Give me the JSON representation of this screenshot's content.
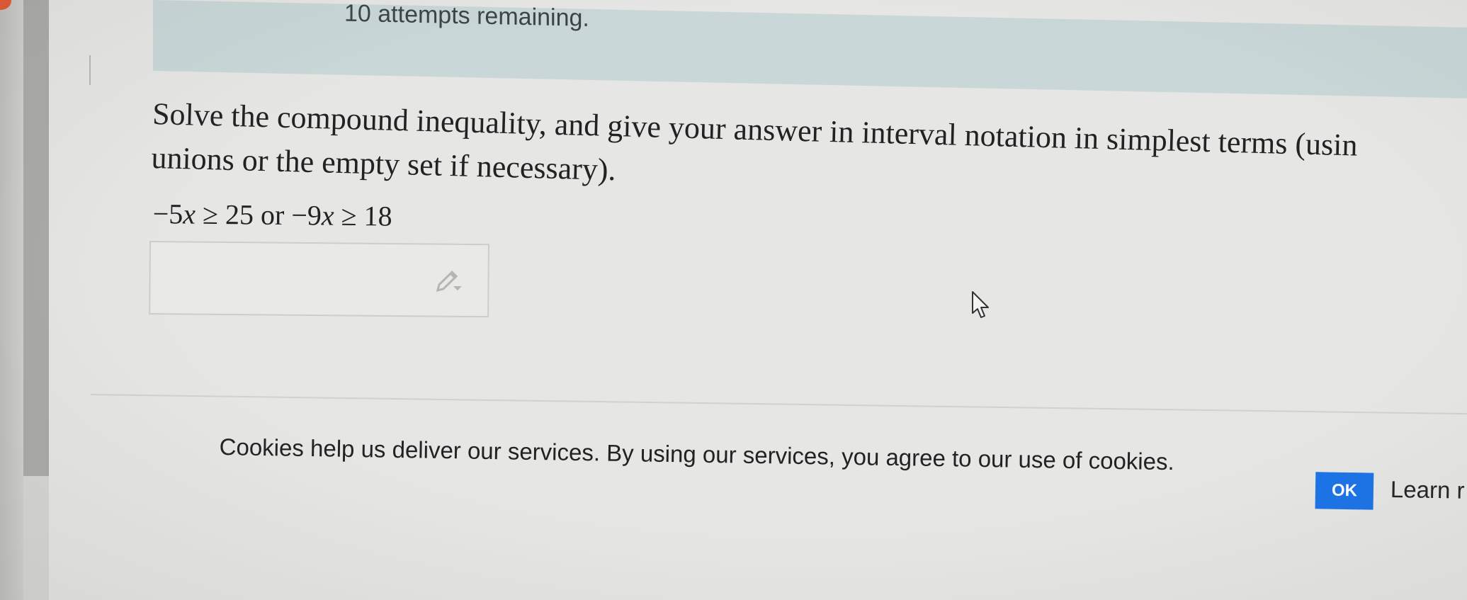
{
  "banner": {
    "attempts_text": "10 attempts remaining."
  },
  "question": {
    "line1": "Solve the compound inequality, and give your answer in interval notation in simplest terms (usin",
    "line2": "unions or the empty set if necessary).",
    "math": {
      "part1_coef": "−5",
      "part1_var": "x",
      "part1_rel": " ≥ 25",
      "connector": " or ",
      "part2_coef": "−9",
      "part2_var": "x",
      "part2_rel": " ≥ 18"
    }
  },
  "answer": {
    "value": "",
    "tool_icon": "pencil-icon"
  },
  "cookie_bar": {
    "message": "Cookies help us deliver our services. By using our services, you agree to our use of cookies.",
    "ok_label": "OK",
    "learn_label": "Learn r",
    "ok_color": "#1a73e8"
  },
  "icons": {
    "cursor": "mouse-pointer-icon"
  }
}
